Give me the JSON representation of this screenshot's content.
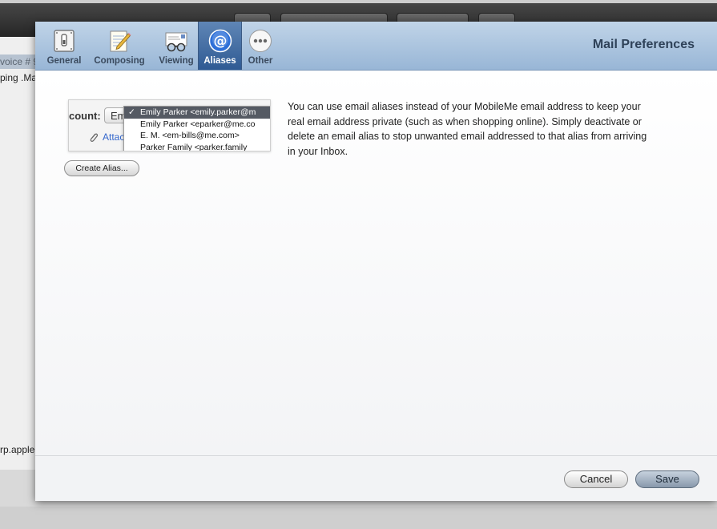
{
  "background": {
    "left_rows": [
      "voice # 9",
      "ping .Ma",
      "rp.apple"
    ]
  },
  "modal": {
    "title": "Mail Preferences",
    "tabs": [
      {
        "label": "General",
        "icon": "switch-icon",
        "active": false
      },
      {
        "label": "Composing",
        "icon": "pencil-notepad-icon",
        "active": false
      },
      {
        "label": "Viewing",
        "icon": "glasses-letter-icon",
        "active": false
      },
      {
        "label": "Aliases",
        "icon": "at-sign-icon",
        "active": true
      },
      {
        "label": "Other",
        "icon": "more-dots-icon",
        "active": false
      }
    ]
  },
  "preview": {
    "account_label": "count:",
    "account_value": "Em",
    "attach_label": "Attac",
    "dropdown_items": [
      {
        "check": "✓",
        "text": "Emily Parker <emily.parker@m",
        "selected": true
      },
      {
        "check": "",
        "text": "Emily Parker <eparker@me.co",
        "selected": false
      },
      {
        "check": "",
        "text": "E. M. <em-bills@me.com>",
        "selected": false
      },
      {
        "check": "",
        "text": "Parker Family <parker.family",
        "selected": false
      }
    ]
  },
  "aliases": {
    "create_button": "Create Alias...",
    "description": "You can use email aliases instead of your MobileMe email address to keep your real email address private (such as when shopping online). Simply deactivate or delete an email alias to stop unwanted email addressed to that alias from arriving in your Inbox."
  },
  "footer": {
    "cancel_label": "Cancel",
    "save_label": "Save"
  },
  "colors": {
    "header_top": "#c0d4e8",
    "header_bottom": "#98b6d6",
    "active_tab": "#2f5a93",
    "title_text": "#2f4259"
  }
}
